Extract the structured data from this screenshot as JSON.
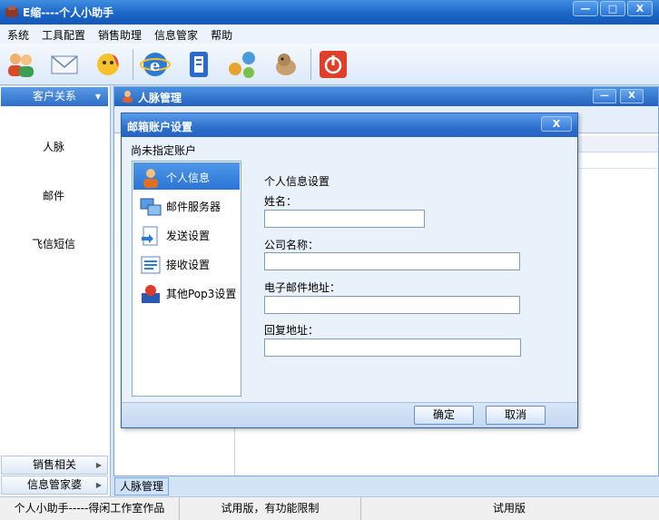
{
  "app": {
    "title": "E缩----个人小助手"
  },
  "window_buttons": {
    "minimize": "—",
    "maximize": "□",
    "close": "X"
  },
  "menu": [
    "系统",
    "工具配置",
    "销售助理",
    "信息管家",
    "帮助"
  ],
  "toolbar": {
    "icons": [
      "contacts-icon",
      "mail-icon",
      "chat-icon",
      "browser-icon",
      "notes-icon",
      "network-icon",
      "pet-icon",
      "power-icon"
    ]
  },
  "left_panel": {
    "header": "客户关系",
    "items": [
      "人脉",
      "邮件",
      "飞信短信"
    ],
    "bottom_sections": [
      "销售相关",
      "信息管家婆"
    ]
  },
  "mdi_window": {
    "title": "人脉管理",
    "minimize": "—",
    "close": "X",
    "tab_label": "人脉管理"
  },
  "dialog": {
    "title": "邮箱账户设置",
    "close": "X",
    "subtitle": "尚未指定账户",
    "nav": [
      {
        "label": "个人信息",
        "icon": "user-info-icon",
        "active": true
      },
      {
        "label": "邮件服务器",
        "icon": "mail-server-icon",
        "active": false
      },
      {
        "label": "发送设置",
        "icon": "send-settings-icon",
        "active": false
      },
      {
        "label": "接收设置",
        "icon": "receive-settings-icon",
        "active": false
      },
      {
        "label": "其他Pop3设置",
        "icon": "pop3-settings-icon",
        "active": false
      }
    ],
    "form": {
      "heading": "个人信息设置",
      "name_label": "姓名：",
      "name_value": "",
      "company_label": "公司名称：",
      "company_value": "",
      "email_label": "电子邮件地址：",
      "email_value": "",
      "reply_label": "回复地址：",
      "reply_value": ""
    },
    "ok_label": "确定",
    "cancel_label": "取消"
  },
  "status_bar": {
    "credit": "个人小助手-----得闲工作室作品",
    "trial_notice": "试用版，有功能限制",
    "edition": "试用版"
  }
}
